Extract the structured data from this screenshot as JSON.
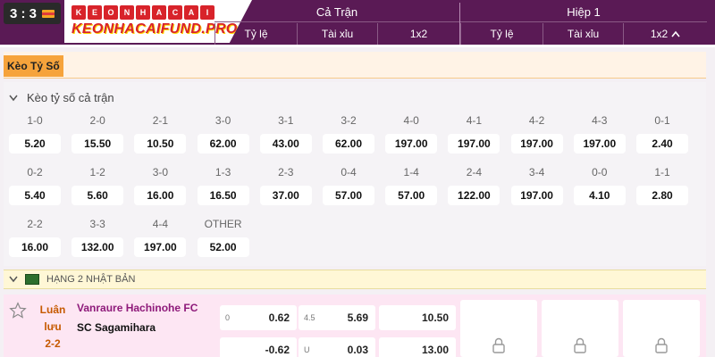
{
  "header": {
    "score_badge": "3 : 3",
    "logo_top_letters": [
      "K",
      "E",
      "O",
      "N",
      "H",
      "A",
      "C",
      "A",
      "I"
    ],
    "logo_bottom": "KEONHACAIFUND.PRO",
    "group_full": "Cả Trận",
    "group_half": "Hiệp 1",
    "cols_full": [
      "Tỷ lệ",
      "Tài xỉu",
      "1x2"
    ],
    "cols_half": [
      "Tỷ lệ",
      "Tài xỉu",
      "1x2"
    ]
  },
  "section": {
    "tab_label": "Kèo Tỷ Số",
    "panel_title": "Kèo tỷ số cả trận"
  },
  "scores": [
    {
      "label": "1-0",
      "odds": "5.20"
    },
    {
      "label": "2-0",
      "odds": "15.50"
    },
    {
      "label": "2-1",
      "odds": "10.50"
    },
    {
      "label": "3-0",
      "odds": "62.00"
    },
    {
      "label": "3-1",
      "odds": "43.00"
    },
    {
      "label": "3-2",
      "odds": "62.00"
    },
    {
      "label": "4-0",
      "odds": "197.00"
    },
    {
      "label": "4-1",
      "odds": "197.00"
    },
    {
      "label": "4-2",
      "odds": "197.00"
    },
    {
      "label": "4-3",
      "odds": "197.00"
    },
    {
      "label": "0-1",
      "odds": "2.40"
    },
    {
      "label": "0-2",
      "odds": "5.40"
    },
    {
      "label": "1-2",
      "odds": "5.60"
    },
    {
      "label": "3-0",
      "odds": "16.00"
    },
    {
      "label": "1-3",
      "odds": "16.50"
    },
    {
      "label": "2-3",
      "odds": "37.00"
    },
    {
      "label": "0-4",
      "odds": "57.00"
    },
    {
      "label": "1-4",
      "odds": "57.00"
    },
    {
      "label": "2-4",
      "odds": "122.00"
    },
    {
      "label": "3-4",
      "odds": "197.00"
    },
    {
      "label": "0-0",
      "odds": "4.10"
    },
    {
      "label": "1-1",
      "odds": "2.80"
    },
    {
      "label": "2-2",
      "odds": "16.00"
    },
    {
      "label": "3-3",
      "odds": "132.00"
    },
    {
      "label": "4-4",
      "odds": "197.00"
    },
    {
      "label": "OTHER",
      "odds": "52.00"
    }
  ],
  "league": {
    "name": "HẠNG 2 NHẬT BẢN"
  },
  "match": {
    "status_line1": "Luân",
    "status_line2": "lưu",
    "status_score": "2-2",
    "home_team": "Vanraure Hachinohe FC",
    "away_team": "SC Sagamihara",
    "handicap_home_line": "0",
    "handicap_home_odds": "0.62",
    "handicap_away_odds": "-0.62",
    "ou_over_line": "4.5",
    "ou_over_odds": "5.69",
    "ou_under_label": "U",
    "ou_under_odds": "0.03",
    "x12_home": "10.50",
    "x12_away": "13.00"
  },
  "colors": {
    "header_bg": "#5a1a55",
    "section_tab": "#f6a33b",
    "home_team": "#8e1a7a",
    "status": "#c65a00",
    "match_bg": "#fde6f3"
  }
}
